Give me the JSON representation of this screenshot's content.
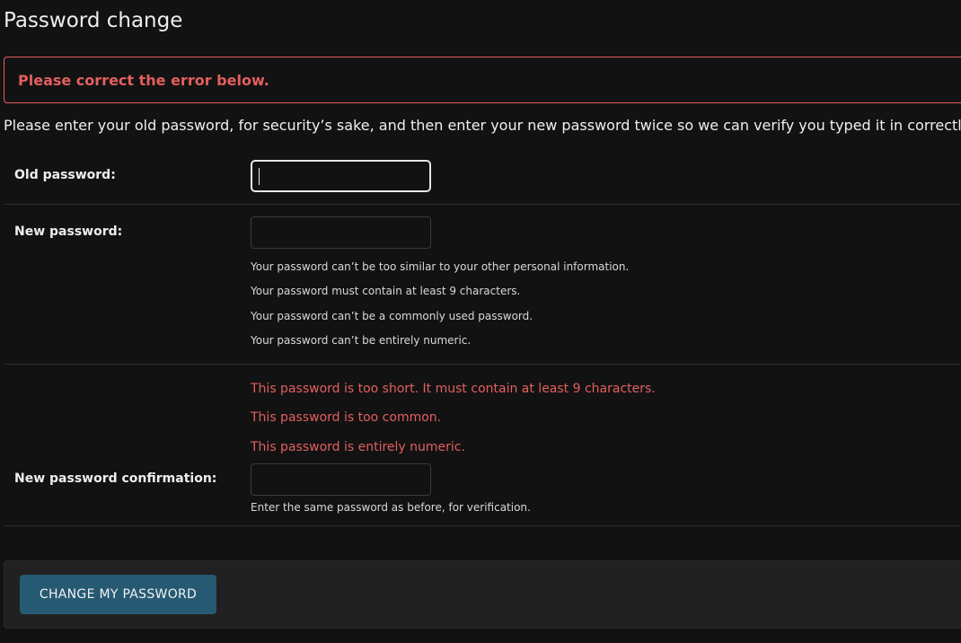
{
  "page": {
    "title": "Password change"
  },
  "errornote": {
    "text": "Please correct the error below."
  },
  "intro": {
    "text": "Please enter your old password, for security’s sake, and then enter your new password twice so we can verify you typed it in correctly."
  },
  "form": {
    "old_password": {
      "label": "Old password:",
      "value": ""
    },
    "new_password1": {
      "label": "New password:",
      "value": "",
      "help": [
        "Your password can’t be too similar to your other personal information.",
        "Your password must contain at least 9 characters.",
        "Your password can’t be a commonly used password.",
        "Your password can’t be entirely numeric."
      ]
    },
    "new_password2": {
      "label": "New password confirmation:",
      "value": "",
      "errors": [
        "This password is too short. It must contain at least 9 characters.",
        "This password is too common.",
        "This password is entirely numeric."
      ],
      "help": "Enter the same password as before, for verification."
    }
  },
  "submit": {
    "label": "CHANGE MY PASSWORD"
  },
  "colors": {
    "background": "#121212",
    "error": "#e35f5f",
    "button": "#265a73"
  }
}
